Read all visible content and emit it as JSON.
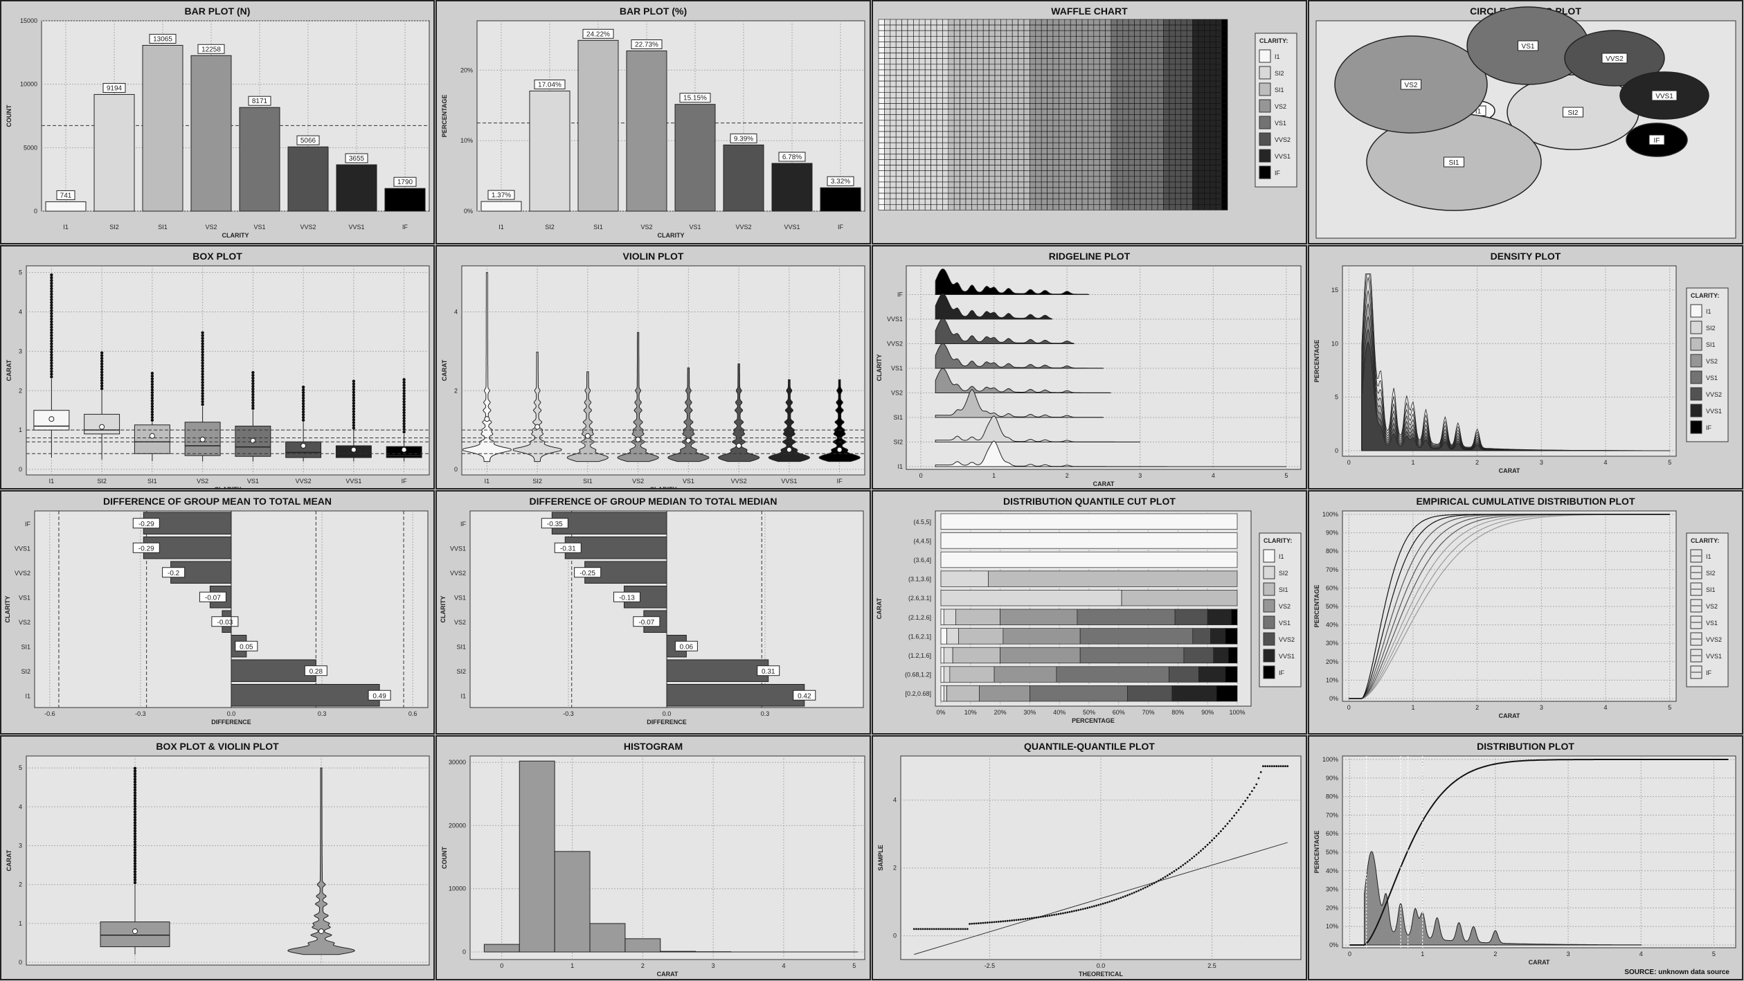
{
  "titles": [
    "BAR PLOT (N)",
    "BAR PLOT (%)",
    "WAFFLE CHART",
    "CIRCLE PACKING PLOT",
    "BOX PLOT",
    "VIOLIN PLOT",
    "RIDGELINE PLOT",
    "DENSITY PLOT",
    "DIFFERENCE OF GROUP MEAN TO TOTAL MEAN",
    "DIFFERENCE OF GROUP MEDIAN TO TOTAL MEDIAN",
    "DISTRIBUTION QUANTILE CUT PLOT",
    "EMPIRICAL CUMULATIVE DISTRIBUTION PLOT",
    "BOX PLOT & VIOLIN PLOT",
    "HISTOGRAM",
    "QUANTILE-QUANTILE PLOT",
    "DISTRIBUTION PLOT"
  ],
  "source": "SOURCE: unknown data source",
  "legend_title": "CLARITY:",
  "colors": {
    "I1": "#f7f7f7",
    "SI2": "#d9d9d9",
    "SI1": "#bdbdbd",
    "VS2": "#969696",
    "VS1": "#737373",
    "VVS2": "#525252",
    "VVS1": "#252525",
    "IF": "#000000",
    "panel_bg": "#e5e5e5",
    "outer_bg": "#cfcfcf"
  },
  "chart_data": [
    {
      "type": "bar",
      "title": "BAR PLOT (N)",
      "categories": [
        "I1",
        "SI2",
        "SI1",
        "VS2",
        "VS1",
        "VVS2",
        "VVS1",
        "IF"
      ],
      "values": [
        741,
        9194,
        13065,
        12258,
        8171,
        5066,
        3655,
        1790
      ],
      "labels": [
        "741",
        "9194",
        "13065",
        "12258",
        "8171",
        "5066",
        "3655",
        "1790"
      ],
      "xlabel": "CLARITY",
      "ylabel": "COUNT",
      "ylim": [
        0,
        15000
      ],
      "yticks": [
        0,
        5000,
        10000,
        15000
      ],
      "ref_line": 6742.5
    },
    {
      "type": "bar",
      "title": "BAR PLOT (%)",
      "categories": [
        "I1",
        "SI2",
        "SI1",
        "VS2",
        "VS1",
        "VVS2",
        "VVS1",
        "IF"
      ],
      "values": [
        1.37,
        17.04,
        24.22,
        22.73,
        15.15,
        9.39,
        6.78,
        3.32
      ],
      "labels": [
        "1.37%",
        "17.04%",
        "24.22%",
        "22.73%",
        "15.15%",
        "9.39%",
        "6.78%",
        "3.32%"
      ],
      "xlabel": "CLARITY",
      "ylabel": "PERCENTAGE",
      "ylim": [
        0,
        27
      ],
      "yticks": [
        0,
        10,
        20
      ],
      "ytick_labels": [
        "0%",
        "10%",
        "20%"
      ],
      "ref_line": 12.5
    },
    {
      "type": "waffle",
      "title": "WAFFLE CHART",
      "categories": [
        "I1",
        "SI2",
        "SI1",
        "VS2",
        "VS1",
        "VVS2",
        "VVS1",
        "IF"
      ],
      "values": [
        1.37,
        17.04,
        24.22,
        22.73,
        15.15,
        9.39,
        6.78,
        3.32
      ],
      "legend_title": "CLARITY:"
    },
    {
      "type": "circle_packing",
      "title": "CIRCLE PACKING PLOT",
      "categories": [
        "I1",
        "SI2",
        "SI1",
        "VS2",
        "VS1",
        "VVS2",
        "VVS1",
        "IF"
      ],
      "values": [
        741,
        9194,
        13065,
        12258,
        8171,
        5066,
        3655,
        1790
      ]
    },
    {
      "type": "box",
      "title": "BOX PLOT",
      "categories": [
        "I1",
        "SI2",
        "SI1",
        "VS2",
        "VS1",
        "VVS2",
        "VVS1",
        "IF"
      ],
      "q1": [
        1.0,
        0.9,
        0.4,
        0.35,
        0.33,
        0.3,
        0.3,
        0.3
      ],
      "median": [
        1.1,
        1.0,
        0.7,
        0.6,
        0.57,
        0.43,
        0.38,
        0.35
      ],
      "q3": [
        1.5,
        1.4,
        1.13,
        1.2,
        1.1,
        0.7,
        0.6,
        0.58
      ],
      "whisker_low": [
        0.3,
        0.25,
        0.21,
        0.2,
        0.2,
        0.2,
        0.2,
        0.2
      ],
      "whisker_high": [
        2.3,
        2.0,
        1.2,
        1.6,
        1.5,
        1.2,
        1.0,
        0.9
      ],
      "mean": [
        1.28,
        1.08,
        0.85,
        0.76,
        0.73,
        0.6,
        0.5,
        0.5
      ],
      "outlier_max": [
        5.0,
        3.0,
        2.5,
        3.5,
        2.5,
        2.1,
        2.3,
        2.3
      ],
      "xlabel": "CLARITY",
      "ylabel": "CARAT",
      "ylim": [
        0,
        5.1
      ],
      "yticks": [
        0,
        1,
        2,
        3,
        4,
        5
      ],
      "ref_lines": [
        0.8,
        0.7,
        0.4,
        1.0
      ]
    },
    {
      "type": "violin",
      "title": "VIOLIN PLOT",
      "categories": [
        "I1",
        "SI2",
        "SI1",
        "VS2",
        "VS1",
        "VVS2",
        "VVS1",
        "IF"
      ],
      "mean": [
        1.28,
        1.08,
        0.85,
        0.76,
        0.73,
        0.6,
        0.5,
        0.5
      ],
      "max": [
        5.0,
        3.0,
        2.5,
        3.5,
        2.6,
        2.7,
        2.3,
        2.3
      ],
      "xlabel": "CLARITY",
      "ylabel": "CARAT",
      "ylim": [
        0,
        5.1
      ],
      "yticks": [
        0,
        2,
        4
      ]
    },
    {
      "type": "ridgeline",
      "title": "RIDGELINE PLOT",
      "categories": [
        "I1",
        "SI2",
        "SI1",
        "VS2",
        "VS1",
        "VVS2",
        "VVS1",
        "IF"
      ],
      "mode": [
        1.0,
        1.0,
        0.7,
        0.3,
        0.3,
        0.3,
        0.3,
        0.3
      ],
      "max": [
        5.0,
        3.0,
        2.5,
        2.6,
        2.5,
        2.1,
        1.8,
        2.3
      ],
      "xlabel": "CARAT",
      "ylabel": "CLARITY",
      "xlim": [
        -0.2,
        5.2
      ],
      "xticks": [
        0,
        1,
        2,
        3,
        4,
        5
      ]
    },
    {
      "type": "area",
      "title": "DENSITY PLOT",
      "categories": [
        "I1",
        "SI2",
        "SI1",
        "VS2",
        "VS1",
        "VVS2",
        "VVS1",
        "IF"
      ],
      "peak_x": 0.3,
      "peak_y": 16.5,
      "xlabel": "CARAT",
      "ylabel": "PERCENTAGE",
      "xlim": [
        -0.1,
        5.1
      ],
      "ylim": [
        0,
        17
      ],
      "xticks": [
        0,
        1,
        2,
        3,
        4,
        5
      ],
      "yticks": [
        0,
        5,
        10,
        15
      ],
      "legend_title": "CLARITY:"
    },
    {
      "type": "bar",
      "orientation": "horizontal",
      "title": "DIFFERENCE OF GROUP MEAN TO TOTAL MEAN",
      "categories": [
        "IF",
        "VVS1",
        "VVS2",
        "VS1",
        "VS2",
        "SI1",
        "SI2",
        "I1"
      ],
      "values": [
        -0.29,
        -0.29,
        -0.2,
        -0.07,
        -0.03,
        0.05,
        0.28,
        0.49
      ],
      "labels": [
        "-0.29",
        "-0.29",
        "-0.2",
        "-0.07",
        "-0.03",
        "0.05",
        "0.28",
        "0.49"
      ],
      "xlabel": "DIFFERENCE",
      "ylabel": "CLARITY",
      "xlim": [
        -0.65,
        0.65
      ],
      "xticks": [
        -0.6,
        -0.3,
        0,
        0.3,
        0.6
      ],
      "xtick_labels": [
        "-0.6",
        "-0.3",
        "0.0",
        "0.3",
        "0.6"
      ],
      "ref_lines": [
        -0.57,
        -0.28,
        0.28,
        0.57
      ]
    },
    {
      "type": "bar",
      "orientation": "horizontal",
      "title": "DIFFERENCE OF GROUP MEDIAN TO TOTAL MEDIAN",
      "categories": [
        "IF",
        "VVS1",
        "VVS2",
        "VS1",
        "VS2",
        "SI1",
        "SI2",
        "I1"
      ],
      "values": [
        -0.35,
        -0.31,
        -0.25,
        -0.13,
        -0.07,
        0.06,
        0.31,
        0.42
      ],
      "labels": [
        "-0.35",
        "-0.31",
        "-0.25",
        "-0.13",
        "-0.07",
        "0.06",
        "0.31",
        "0.42"
      ],
      "xlabel": "DIFFERENCE",
      "ylabel": "CLARITY",
      "xlim": [
        -0.6,
        0.6
      ],
      "xticks": [
        -0.3,
        0,
        0.3
      ],
      "xtick_labels": [
        "-0.3",
        "0.0",
        "0.3"
      ],
      "ref_lines": [
        -0.29,
        0.29
      ]
    },
    {
      "type": "bar",
      "orientation": "horizontal",
      "stacked": true,
      "title": "DISTRIBUTION QUANTILE CUT PLOT",
      "categories": [
        "(4.5,5]",
        "(4,4.5]",
        "(3.6,4]",
        "(3.1,3.6]",
        "(2.6,3.1]",
        "(2.1,2.6]",
        "(1.6,2.1]",
        "(1.2,1.6]",
        "(0.68,1.2]",
        "[0.2,0.68]"
      ],
      "series": [
        {
          "name": "I1",
          "values": [
            100,
            100,
            100,
            0,
            0,
            1,
            2,
            1,
            1,
            1
          ]
        },
        {
          "name": "SI2",
          "values": [
            0,
            0,
            0,
            16,
            61,
            4,
            4,
            3,
            2,
            1
          ]
        },
        {
          "name": "SI1",
          "values": [
            0,
            0,
            0,
            84,
            39,
            15,
            15,
            16,
            15,
            11
          ]
        },
        {
          "name": "VS2",
          "values": [
            0,
            0,
            0,
            0,
            0,
            26,
            26,
            27,
            21,
            17
          ]
        },
        {
          "name": "VS1",
          "values": [
            0,
            0,
            0,
            0,
            0,
            33,
            38,
            35,
            38,
            33
          ]
        },
        {
          "name": "VVS2",
          "values": [
            0,
            0,
            0,
            0,
            0,
            11,
            6,
            10,
            10,
            15
          ]
        },
        {
          "name": "VVS1",
          "values": [
            0,
            0,
            0,
            0,
            0,
            8,
            5,
            5,
            9,
            15
          ]
        },
        {
          "name": "IF",
          "values": [
            0,
            0,
            0,
            0,
            0,
            2,
            4,
            3,
            4,
            7
          ]
        }
      ],
      "xlabel": "PERCENTAGE",
      "ylabel": "CARAT",
      "xticks": [
        0,
        10,
        20,
        30,
        40,
        50,
        60,
        70,
        80,
        90,
        100
      ],
      "xtick_labels": [
        "0%",
        "10%",
        "20%",
        "30%",
        "40%",
        "50%",
        "60%",
        "70%",
        "80%",
        "90%",
        "100%"
      ],
      "legend_title": "CLARITY:"
    },
    {
      "type": "line",
      "title": "EMPIRICAL CUMULATIVE DISTRIBUTION PLOT",
      "categories": [
        "I1",
        "SI2",
        "SI1",
        "VS2",
        "VS1",
        "VVS2",
        "VVS1",
        "IF"
      ],
      "xlabel": "CARAT",
      "ylabel": "PERCENTAGE",
      "xlim": [
        -0.1,
        5.1
      ],
      "ylim": [
        0,
        100
      ],
      "xticks": [
        0,
        1,
        2,
        3,
        4,
        5
      ],
      "yticks": [
        0,
        10,
        20,
        30,
        40,
        50,
        60,
        70,
        80,
        90,
        100
      ],
      "ytick_labels": [
        "0%",
        "10%",
        "20%",
        "30%",
        "40%",
        "50%",
        "60%",
        "70%",
        "80%",
        "90%",
        "100%"
      ],
      "legend_title": "CLARITY:"
    },
    {
      "type": "box",
      "title": "BOX PLOT & VIOLIN PLOT",
      "q1": 0.4,
      "median": 0.7,
      "q3": 1.04,
      "whisker_low": 0.2,
      "whisker_high": 2.0,
      "mean": 0.8,
      "outlier_max": 5.01,
      "ylabel": "CARAT",
      "ylim": [
        0,
        5.2
      ],
      "yticks": [
        0,
        1,
        2,
        3,
        4,
        5
      ]
    },
    {
      "type": "bar",
      "title": "HISTOGRAM",
      "x": [
        0.0,
        0.5,
        1.0,
        1.5,
        2.0,
        2.5,
        3.0
      ],
      "values": [
        1200,
        30200,
        15900,
        4500,
        2100,
        100,
        40
      ],
      "xlabel": "CARAT",
      "ylabel": "COUNT",
      "xlim": [
        -0.45,
        5.15
      ],
      "ylim": [
        -1200,
        31000
      ],
      "xticks": [
        0,
        1,
        2,
        3,
        4,
        5
      ],
      "yticks": [
        0,
        10000,
        20000,
        30000
      ]
    },
    {
      "type": "scatter",
      "title": "QUANTILE-QUANTILE PLOT",
      "xlabel": "THEORETICAL",
      "ylabel": "SAMPLE",
      "xlim": [
        -4.5,
        4.5
      ],
      "ylim": [
        -0.7,
        5.3
      ],
      "xticks": [
        -2.5,
        0,
        2.5
      ],
      "xtick_labels": [
        "-2.5",
        "0.0",
        "2.5"
      ],
      "yticks": [
        0,
        2,
        4
      ],
      "line": [
        [
          -4.2,
          -0.55
        ],
        [
          4.2,
          2.75
        ]
      ]
    },
    {
      "type": "area",
      "title": "DISTRIBUTION PLOT",
      "xlabel": "CARAT",
      "ylabel": "PERCENTAGE",
      "xlim": [
        -0.1,
        5.3
      ],
      "ylim": [
        0,
        100
      ],
      "xticks": [
        0,
        1,
        2,
        3,
        4,
        5
      ],
      "yticks": [
        0,
        10,
        20,
        30,
        40,
        50,
        60,
        70,
        80,
        90,
        100
      ],
      "ytick_labels": [
        "0%",
        "10%",
        "20%",
        "30%",
        "40%",
        "50%",
        "60%",
        "70%",
        "80%",
        "90%",
        "100%"
      ],
      "ref_lines": [
        0.23,
        0.7,
        0.8,
        1.0
      ]
    }
  ]
}
